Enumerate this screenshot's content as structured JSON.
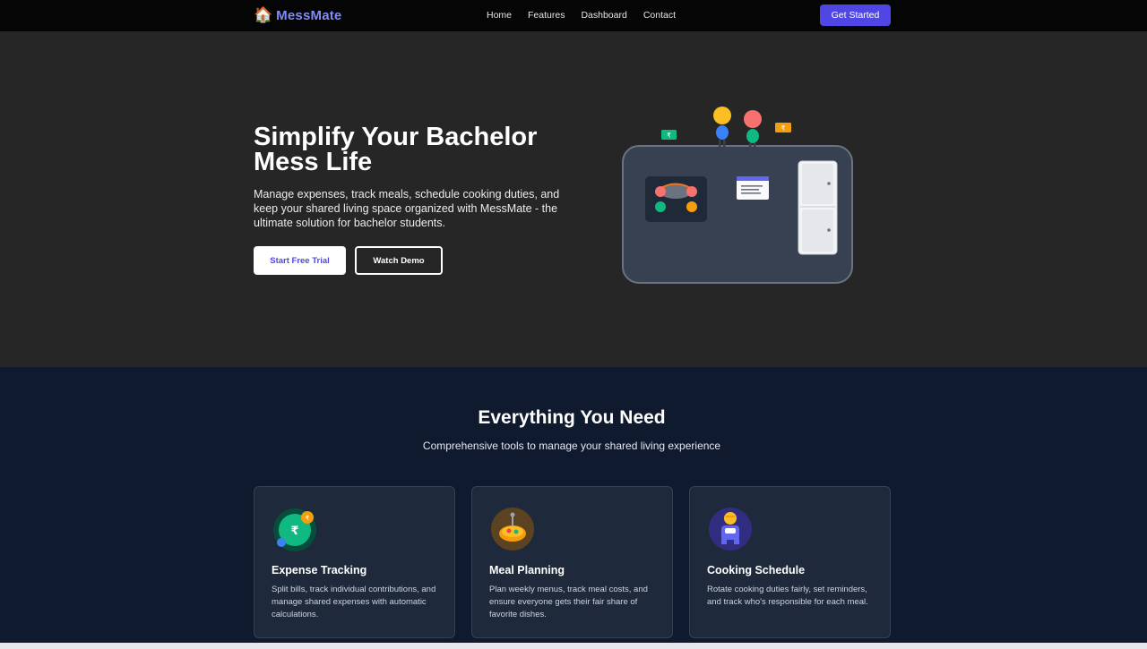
{
  "nav": {
    "logo_icon": "🏠",
    "logo_text": "MessMate",
    "links": [
      "Home",
      "Features",
      "Dashboard",
      "Contact"
    ],
    "cta": "Get Started"
  },
  "hero": {
    "title": "Simplify Your Bachelor Mess Life",
    "description": "Manage expenses, track meals, schedule cooking duties, and keep your shared living space organized with MessMate - the ultimate solution for bachelor students.",
    "primary_button": "Start Free Trial",
    "secondary_button": "Watch Demo",
    "currency_symbol": "₹"
  },
  "features": {
    "title": "Everything You Need",
    "subtitle": "Comprehensive tools to manage your shared living experience",
    "cards": [
      {
        "icon": "expense-icon",
        "title": "Expense Tracking",
        "description": "Split bills, track individual contributions, and manage shared expenses with automatic calculations."
      },
      {
        "icon": "meal-icon",
        "title": "Meal Planning",
        "description": "Plan weekly menus, track meal costs, and ensure everyone gets their fair share of favorite dishes."
      },
      {
        "icon": "chef-icon",
        "title": "Cooking Schedule",
        "description": "Rotate cooking duties fairly, set reminders, and track who's responsible for each meal."
      }
    ]
  },
  "colors": {
    "brand": "#818cf8",
    "accent": "#4f46e5",
    "hero_bg": "#262626",
    "features_bg": "#101a2e",
    "card_bg": "#1e293b"
  }
}
